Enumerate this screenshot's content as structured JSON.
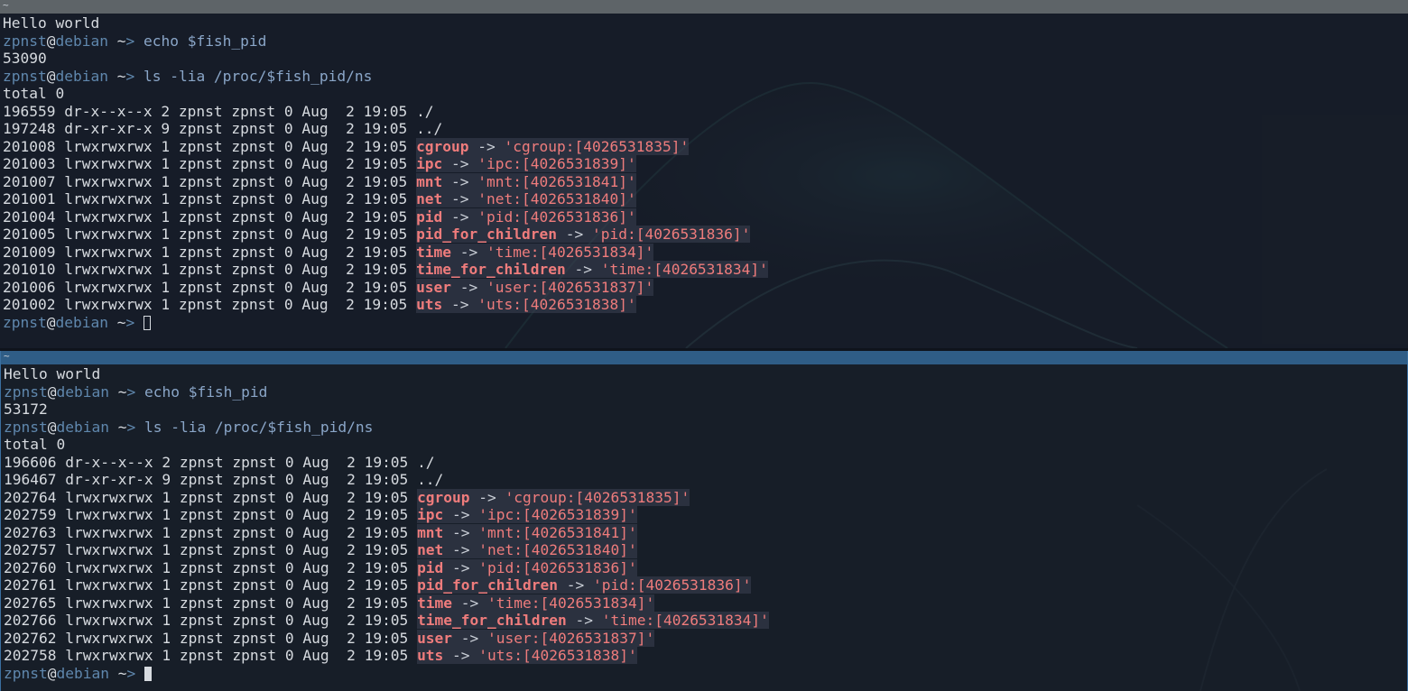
{
  "top_pane": {
    "title": "~",
    "greeting": "Hello world",
    "prompt": {
      "user": "zpnst",
      "at": "@",
      "host": "debian",
      "cwd": " ~",
      "symbol": ">"
    },
    "cmd1": "echo $fish_pid",
    "pid": "53090",
    "cmd2": "ls -lia /proc/$fish_pid/ns",
    "total": "total 0",
    "rows": [
      {
        "meta": "196559 dr-x--x--x 2 zpnst zpnst 0 Aug  2 19:05 ",
        "name": "./",
        "target": ""
      },
      {
        "meta": "197248 dr-xr-xr-x 9 zpnst zpnst 0 Aug  2 19:05 ",
        "name": "../",
        "target": ""
      },
      {
        "meta": "201008 lrwxrwxrwx 1 zpnst zpnst 0 Aug  2 19:05 ",
        "name": "cgroup",
        "target": "'cgroup:[4026531835]'"
      },
      {
        "meta": "201003 lrwxrwxrwx 1 zpnst zpnst 0 Aug  2 19:05 ",
        "name": "ipc",
        "target": "'ipc:[4026531839]'"
      },
      {
        "meta": "201007 lrwxrwxrwx 1 zpnst zpnst 0 Aug  2 19:05 ",
        "name": "mnt",
        "target": "'mnt:[4026531841]'"
      },
      {
        "meta": "201001 lrwxrwxrwx 1 zpnst zpnst 0 Aug  2 19:05 ",
        "name": "net",
        "target": "'net:[4026531840]'"
      },
      {
        "meta": "201004 lrwxrwxrwx 1 zpnst zpnst 0 Aug  2 19:05 ",
        "name": "pid",
        "target": "'pid:[4026531836]'"
      },
      {
        "meta": "201005 lrwxrwxrwx 1 zpnst zpnst 0 Aug  2 19:05 ",
        "name": "pid_for_children",
        "target": "'pid:[4026531836]'"
      },
      {
        "meta": "201009 lrwxrwxrwx 1 zpnst zpnst 0 Aug  2 19:05 ",
        "name": "time",
        "target": "'time:[4026531834]'"
      },
      {
        "meta": "201010 lrwxrwxrwx 1 zpnst zpnst 0 Aug  2 19:05 ",
        "name": "time_for_children",
        "target": "'time:[4026531834]'"
      },
      {
        "meta": "201006 lrwxrwxrwx 1 zpnst zpnst 0 Aug  2 19:05 ",
        "name": "user",
        "target": "'user:[4026531837]'"
      },
      {
        "meta": "201002 lrwxrwxrwx 1 zpnst zpnst 0 Aug  2 19:05 ",
        "name": "uts",
        "target": "'uts:[4026531838]'"
      }
    ]
  },
  "bottom_pane": {
    "title": "~",
    "greeting": "Hello world",
    "prompt": {
      "user": "zpnst",
      "at": "@",
      "host": "debian",
      "cwd": " ~",
      "symbol": ">"
    },
    "cmd1": "echo $fish_pid",
    "pid": "53172",
    "cmd2": "ls -lia /proc/$fish_pid/ns",
    "total": "total 0",
    "rows": [
      {
        "meta": "196606 dr-x--x--x 2 zpnst zpnst 0 Aug  2 19:05 ",
        "name": "./",
        "target": ""
      },
      {
        "meta": "196467 dr-xr-xr-x 9 zpnst zpnst 0 Aug  2 19:05 ",
        "name": "../",
        "target": ""
      },
      {
        "meta": "202764 lrwxrwxrwx 1 zpnst zpnst 0 Aug  2 19:05 ",
        "name": "cgroup",
        "target": "'cgroup:[4026531835]'"
      },
      {
        "meta": "202759 lrwxrwxrwx 1 zpnst zpnst 0 Aug  2 19:05 ",
        "name": "ipc",
        "target": "'ipc:[4026531839]'"
      },
      {
        "meta": "202763 lrwxrwxrwx 1 zpnst zpnst 0 Aug  2 19:05 ",
        "name": "mnt",
        "target": "'mnt:[4026531841]'"
      },
      {
        "meta": "202757 lrwxrwxrwx 1 zpnst zpnst 0 Aug  2 19:05 ",
        "name": "net",
        "target": "'net:[4026531840]'"
      },
      {
        "meta": "202760 lrwxrwxrwx 1 zpnst zpnst 0 Aug  2 19:05 ",
        "name": "pid",
        "target": "'pid:[4026531836]'"
      },
      {
        "meta": "202761 lrwxrwxrwx 1 zpnst zpnst 0 Aug  2 19:05 ",
        "name": "pid_for_children",
        "target": "'pid:[4026531836]'"
      },
      {
        "meta": "202765 lrwxrwxrwx 1 zpnst zpnst 0 Aug  2 19:05 ",
        "name": "time",
        "target": "'time:[4026531834]'"
      },
      {
        "meta": "202766 lrwxrwxrwx 1 zpnst zpnst 0 Aug  2 19:05 ",
        "name": "time_for_children",
        "target": "'time:[4026531834]'"
      },
      {
        "meta": "202762 lrwxrwxrwx 1 zpnst zpnst 0 Aug  2 19:05 ",
        "name": "user",
        "target": "'user:[4026531837]'"
      },
      {
        "meta": "202758 lrwxrwxrwx 1 zpnst zpnst 0 Aug  2 19:05 ",
        "name": "uts",
        "target": "'uts:[4026531838]'"
      }
    ]
  }
}
